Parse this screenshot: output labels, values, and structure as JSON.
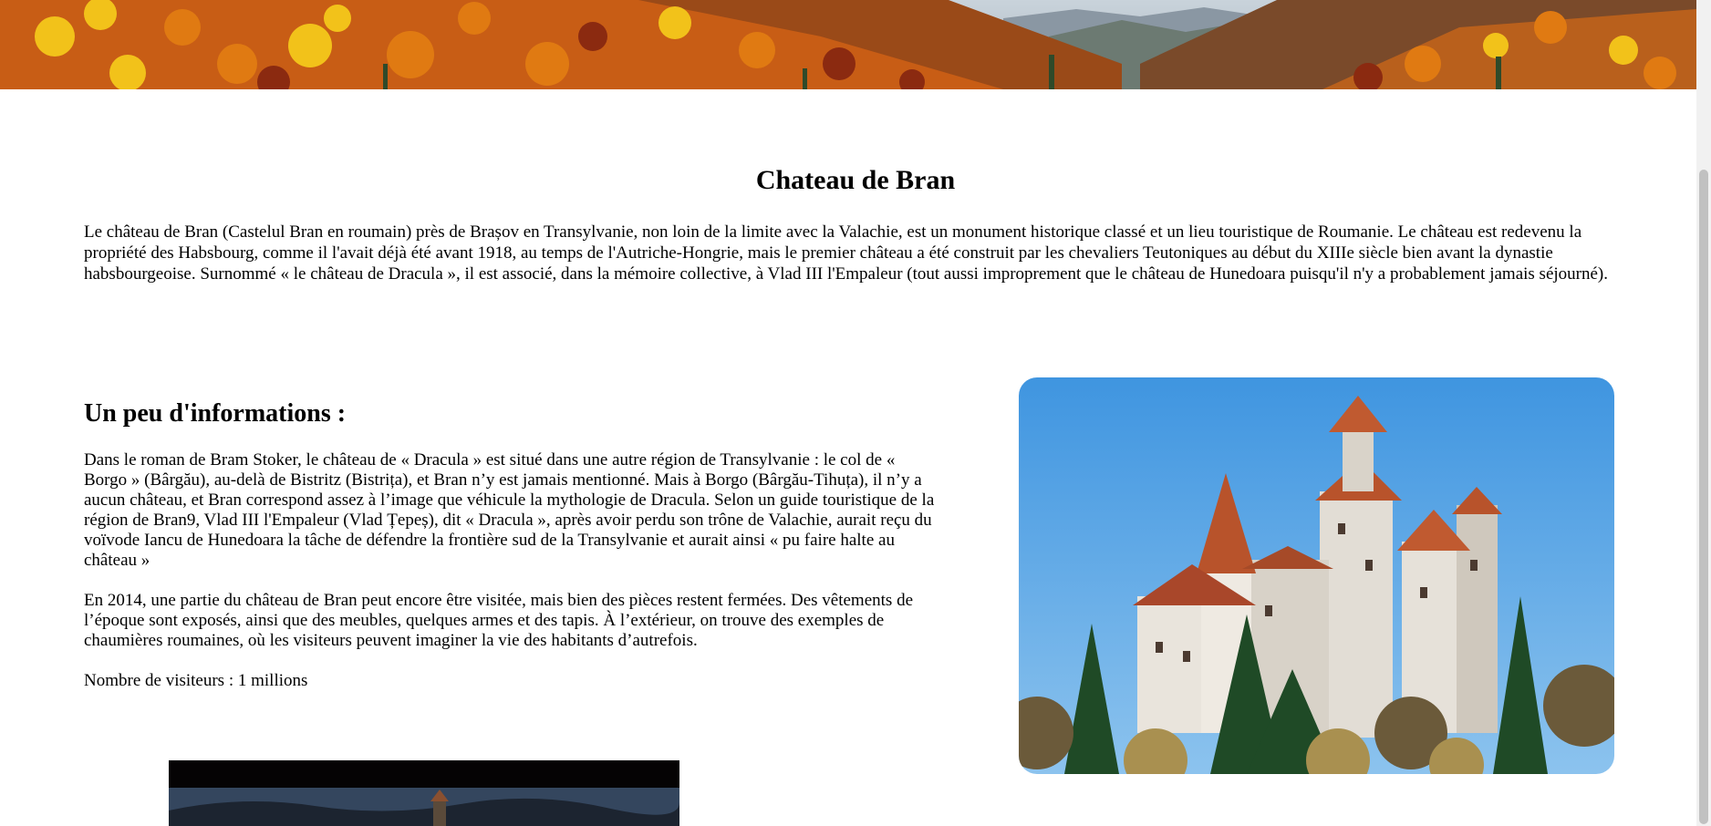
{
  "page": {
    "title": "Chateau de Bran",
    "intro": "Le château de Bran (Castelul Bran en roumain) près de Brașov en Transylvanie, non loin de la limite avec la Valachie, est un monument historique classé et un lieu touristique de Roumanie. Le château est redevenu la propriété des Habsbourg, comme il l'avait déjà été avant 1918, au temps de l'Autriche-Hongrie, mais le premier château a été construit par les chevaliers Teutoniques au début du XIIIe siècle bien avant la dynastie habsbourgeoise. Surnommé « le château de Dracula », il est associé, dans la mémoire collective, à Vlad III l'Empaleur (tout aussi improprement que le château de Hunedoara puisqu'il n'y a probablement jamais séjourné)."
  },
  "info": {
    "heading": "Un peu d'informations :",
    "paragraph1": "Dans le roman de Bram Stoker, le château de « Dracula » est situé dans une autre région de Transylvanie : le col de « Borgo » (Bârgău), au-delà de Bistritz (Bistrița), et Bran n’y est jamais mentionné. Mais à Borgo (Bârgău-Tihuța), il n’y a aucun château, et Bran correspond assez à l’image que véhicule la mythologie de Dracula. Selon un guide touristique de la région de Bran9, Vlad III l'Empaleur (Vlad Țepeș), dit « Dracula », après avoir perdu son trône de Valachie, aurait reçu du voïvode Iancu de Hunedoara la tâche de défendre la frontière sud de la Transylvanie et aurait ainsi « pu faire halte au château »",
    "paragraph2": "En 2014, une partie du château de Bran peut encore être visitée, mais bien des pièces restent fermées. Des vêtements de l’époque sont exposés, ainsi que des meubles, quelques armes et des tapis. À l’extérieur, on trouve des exemples de chaumières roumaines, où les visiteurs peuvent imaginer la vie des habitants d’autrefois.",
    "visitors": "Nombre de visiteurs : 1 millions"
  },
  "images": {
    "banner": "autumn-forest-banner",
    "castle": "bran-castle-photo",
    "bottom": "castle-night-photo"
  },
  "colors": {
    "sky": "#4a9fe0",
    "roof": "#b8532b",
    "forest_orange": "#d9731c"
  }
}
